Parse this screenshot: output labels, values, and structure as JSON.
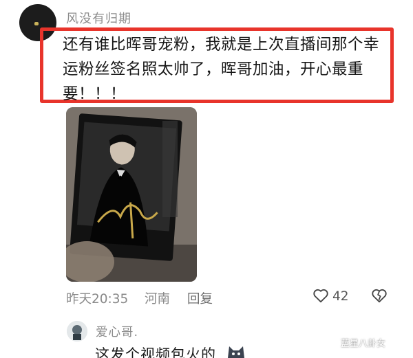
{
  "comment": {
    "username": "风没有归期",
    "text": "还有谁比晖哥宠粉，我就是上次直播间那个幸运粉丝签名照太帅了，晖哥加油，开心最重要！！！",
    "time": "昨天20:35",
    "location": "河南",
    "reply_label": "回复",
    "like_count": "42",
    "highlight_color": "#e8342b"
  },
  "reply": {
    "username": "爱心哥.",
    "text": "这发个视频包火的"
  },
  "watermark": {
    "text": "蓝星八卦女"
  },
  "icons": {
    "like": "heart-outline-icon",
    "dislike": "broken-heart-icon",
    "emoji": "cat-emoji-icon"
  }
}
